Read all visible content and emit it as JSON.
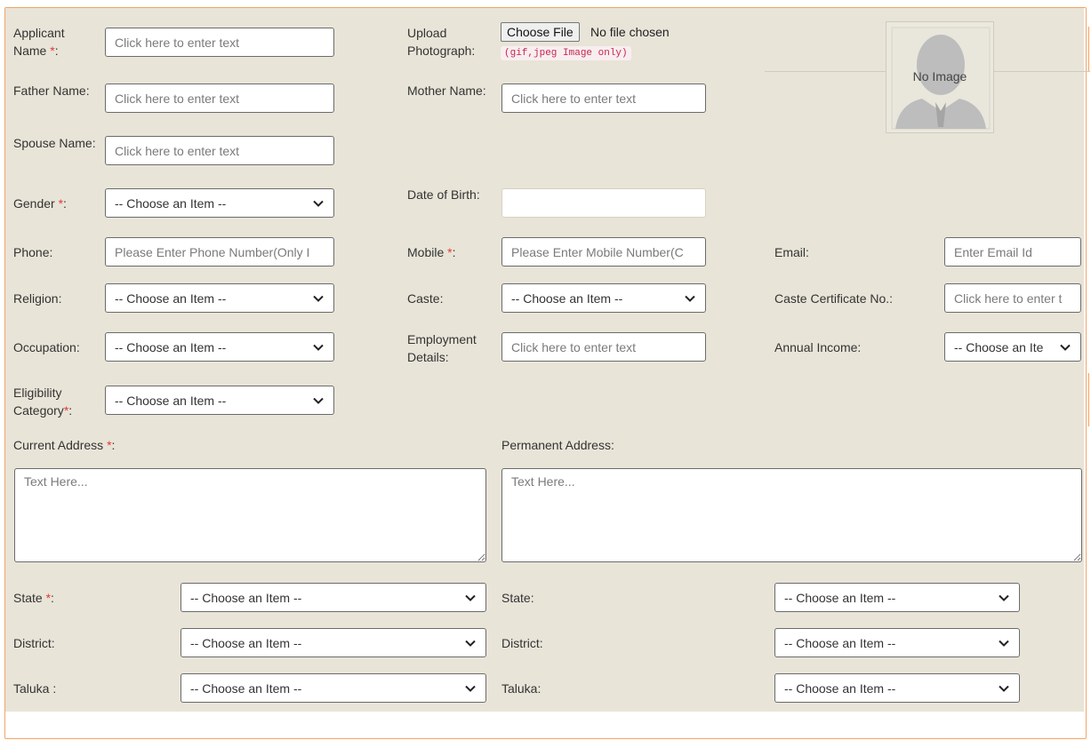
{
  "required_mark": "*",
  "applicant_name": {
    "label": "Applicant Name ",
    "suffix": ":",
    "placeholder": "Click here to enter text"
  },
  "upload_photo": {
    "label": "Upload Photograph:",
    "button": "Choose File",
    "status": "No file chosen",
    "hint": "(gif,jpeg Image only)"
  },
  "photo_preview": {
    "text": "No Image"
  },
  "father_name": {
    "label": "Father Name:",
    "placeholder": "Click here to enter text"
  },
  "mother_name": {
    "label": "Mother Name:",
    "placeholder": "Click here to enter text"
  },
  "spouse_name": {
    "label": "Spouse Name:",
    "placeholder": "Click here to enter text"
  },
  "gender": {
    "label": "Gender ",
    "suffix": ":",
    "value": "-- Choose an Item --"
  },
  "dob": {
    "label": "Date of Birth:",
    "value": ""
  },
  "phone": {
    "label": "Phone:",
    "placeholder": "Please Enter Phone Number(Only I"
  },
  "mobile": {
    "label": "Mobile ",
    "suffix": ":",
    "placeholder": "Please Enter Mobile Number(C"
  },
  "email": {
    "label": "Email:",
    "placeholder": "Enter Email Id"
  },
  "religion": {
    "label": "Religion:",
    "value": "-- Choose an Item --"
  },
  "caste": {
    "label": "Caste:",
    "value": "-- Choose an Item --"
  },
  "caste_cert": {
    "label": "Caste Certificate No.:",
    "placeholder": "Click here to enter t"
  },
  "occupation": {
    "label": "Occupation:",
    "value": "-- Choose an Item --"
  },
  "employment": {
    "label": "Employment Details:",
    "placeholder": "Click here to enter text"
  },
  "annual_income": {
    "label": "Annual Income:",
    "value": "-- Choose an Ite"
  },
  "eligibility": {
    "label": "Eligibility Category",
    "suffix": ":",
    "value": "-- Choose an Item --"
  },
  "current_address": {
    "label": "Current Address ",
    "suffix": ":",
    "placeholder": "Text Here..."
  },
  "permanent_address": {
    "label": "Permanent Address:",
    "placeholder": "Text Here..."
  },
  "current": {
    "state": {
      "label": "State ",
      "suffix": ":",
      "value": "-- Choose an Item --"
    },
    "district": {
      "label": "District:",
      "value": "-- Choose an Item --"
    },
    "taluka": {
      "label": "Taluka :",
      "value": "-- Choose an Item --"
    }
  },
  "permanent": {
    "state": {
      "label": "State:",
      "value": "-- Choose an Item --"
    },
    "district": {
      "label": "District:",
      "value": "-- Choose an Item --"
    },
    "taluka": {
      "label": "Taluka:",
      "value": "-- Choose an Item --"
    }
  },
  "colors": {
    "required": "#e53935",
    "form_bg": "#e8e4d8",
    "frame_border": "#f2a566",
    "hint_text": "#c7254e"
  }
}
